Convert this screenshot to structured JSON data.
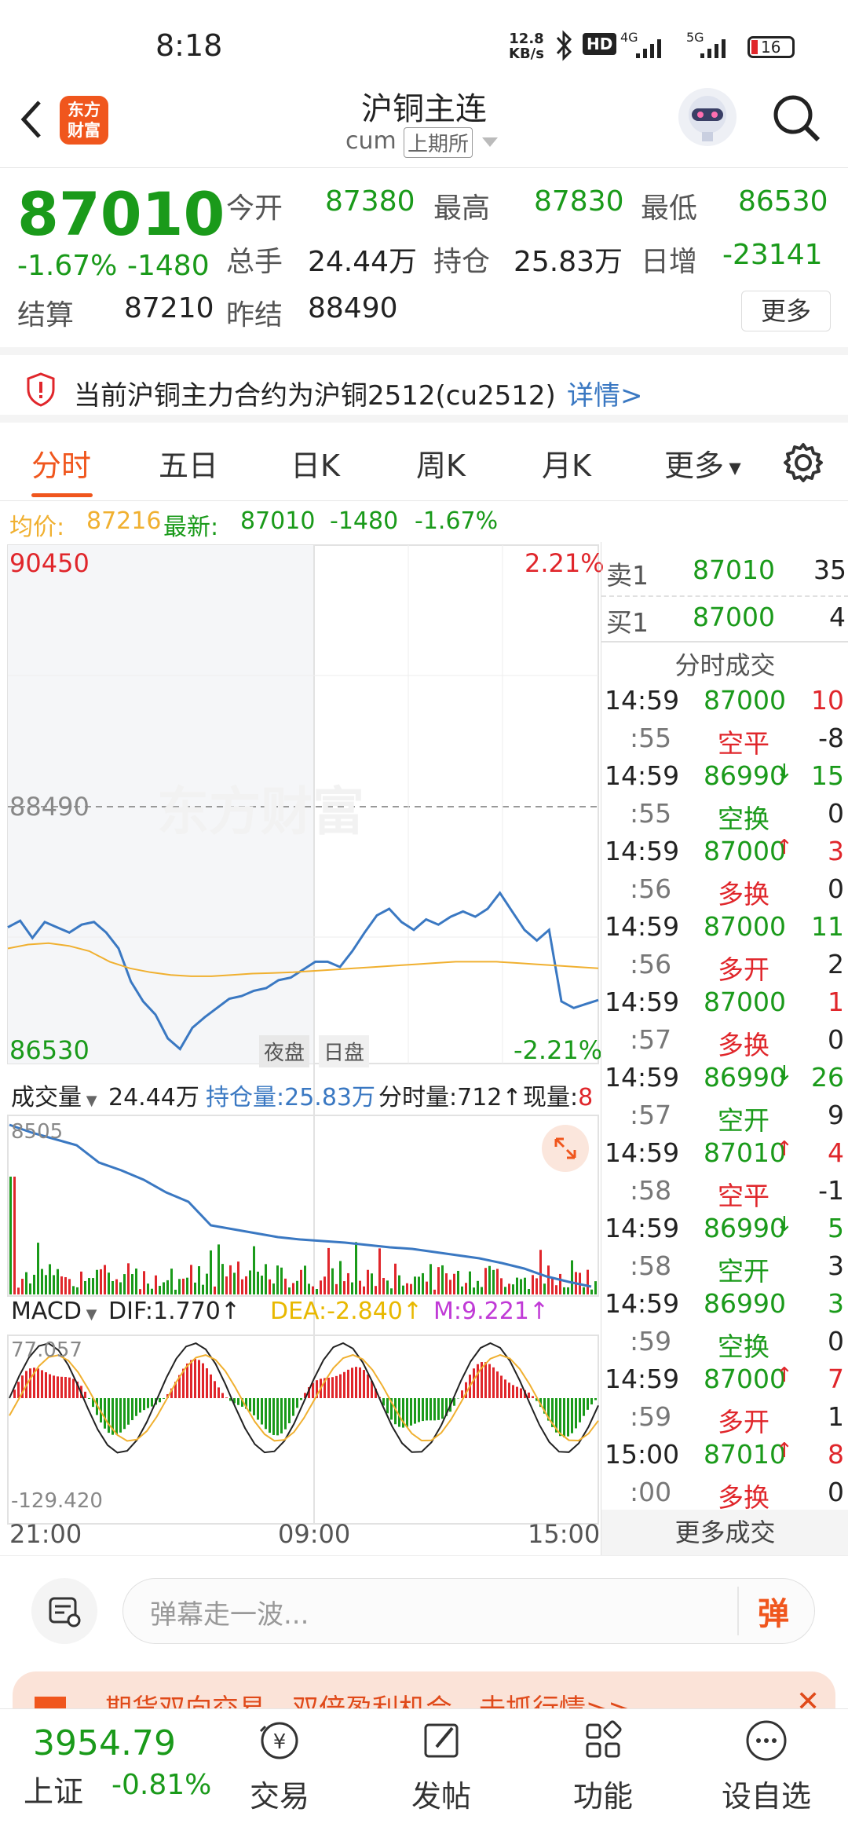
{
  "status": {
    "time": "8:18",
    "net_speed_top": "12.8",
    "net_speed_bottom": "KB/s",
    "hd": "HD",
    "net1": "4G",
    "net2": "5G",
    "battery": "16"
  },
  "header": {
    "title": "沪铜主连",
    "subtitle_code": "cum",
    "exchange": "上期所",
    "logo_line1": "东方",
    "logo_line2": "财富"
  },
  "quote": {
    "last": "87010",
    "change_pct": "-1.67%",
    "change": "-1480",
    "open_label": "今开",
    "open": "87380",
    "high_label": "最高",
    "high": "87830",
    "low_label": "最低",
    "low": "86530",
    "volume_label": "总手",
    "volume": "24.44万",
    "oi_label": "持仓",
    "oi": "25.83万",
    "oi_chg_label": "日增",
    "oi_chg": "-23141",
    "settle_label": "结算",
    "settle": "87210",
    "prev_settle_label": "昨结",
    "prev_settle": "88490",
    "more": "更多"
  },
  "notice": {
    "text": "当前沪铜主力合约为沪铜2512(cu2512)",
    "link": "详情>"
  },
  "tabs": [
    "分时",
    "五日",
    "日K",
    "周K",
    "月K",
    "更多"
  ],
  "avgline": {
    "avg_label": "均价:",
    "avg": "87216",
    "latest_label": "最新:",
    "latest": "87010",
    "chg": "-1480",
    "pct": "-1.67%"
  },
  "chart": {
    "y_high": "90450",
    "y_low": "86530",
    "y_ref": "88490",
    "pct_high": "2.21%",
    "pct_low": "-2.21%",
    "session_night": "夜盘",
    "session_day": "日盘",
    "watermark": "东方财富",
    "vol_select": "成交量",
    "vol_val": "24.44万",
    "oi_label": "持仓量:25.83万",
    "tick_vol": "分时量:712↑",
    "cur_vol_label": "现量:",
    "cur_vol": "8",
    "vol_max": "8505",
    "macd_select": "MACD",
    "dif": "DIF:1.770↑",
    "dea": "DEA:-2.840↑",
    "m": "M:9.221↑",
    "macd_max": "77.057",
    "macd_min": "-129.420",
    "x_start": "21:00",
    "x_mid": "09:00",
    "x_end": "15:00"
  },
  "chart_data": {
    "type": "line",
    "title": "",
    "x_labels": [
      "21:00",
      "09:00",
      "15:00"
    ],
    "ylim": [
      86530,
      90450
    ],
    "reference": 88490,
    "series": [
      {
        "values": [
          87560,
          87610,
          87480,
          87600,
          87560,
          87520,
          87580,
          87600,
          87520,
          87400,
          87150,
          87000,
          86900,
          86720,
          86640,
          86800,
          86880,
          86950,
          87020,
          87040,
          87080,
          87100,
          87160,
          87180,
          87240,
          87300,
          87300,
          87260,
          87380,
          87520,
          87650,
          87700,
          87600,
          87540,
          87620,
          87580,
          87640,
          87680,
          87640,
          87700,
          87820,
          87680,
          87540,
          87460,
          87540,
          87000,
          86950,
          86980,
          87010
        ]
      },
      {
        "values": [
          87400,
          87430,
          87440,
          87420,
          87380,
          87300,
          87250,
          87220,
          87200,
          87190,
          87190,
          87200,
          87210,
          87215,
          87220,
          87230,
          87240,
          87250,
          87260,
          87270,
          87280,
          87290,
          87300,
          87300,
          87300,
          87290,
          87280,
          87270,
          87260,
          87250
        ]
      }
    ]
  },
  "orderbook": {
    "ask_label": "卖1",
    "ask": "87010",
    "ask_vol": "35",
    "bid_label": "买1",
    "bid": "87000",
    "bid_vol": "4",
    "title": "分时成交",
    "trades": [
      {
        "t": "14:59",
        "p": "87000",
        "a": "",
        "v": "10",
        "pc": "green",
        "vc": "red"
      },
      {
        "t": ":55",
        "p": "空平",
        "a": "",
        "v": "-8",
        "pc": "red",
        "vc": "dark"
      },
      {
        "t": "14:59",
        "p": "86990",
        "a": "↓",
        "v": "15",
        "pc": "green",
        "vc": "green"
      },
      {
        "t": ":55",
        "p": "空换",
        "a": "",
        "v": "0",
        "pc": "green",
        "vc": "dark"
      },
      {
        "t": "14:59",
        "p": "87000",
        "a": "↑",
        "v": "3",
        "pc": "green",
        "vc": "red"
      },
      {
        "t": ":56",
        "p": "多换",
        "a": "",
        "v": "0",
        "pc": "red",
        "vc": "dark"
      },
      {
        "t": "14:59",
        "p": "87000",
        "a": "",
        "v": "11",
        "pc": "green",
        "vc": "green"
      },
      {
        "t": ":56",
        "p": "多开",
        "a": "",
        "v": "2",
        "pc": "red",
        "vc": "dark"
      },
      {
        "t": "14:59",
        "p": "87000",
        "a": "",
        "v": "1",
        "pc": "green",
        "vc": "red"
      },
      {
        "t": ":57",
        "p": "多换",
        "a": "",
        "v": "0",
        "pc": "red",
        "vc": "dark"
      },
      {
        "t": "14:59",
        "p": "86990",
        "a": "↓",
        "v": "26",
        "pc": "green",
        "vc": "green"
      },
      {
        "t": ":57",
        "p": "空开",
        "a": "",
        "v": "9",
        "pc": "green",
        "vc": "dark"
      },
      {
        "t": "14:59",
        "p": "87010",
        "a": "↑",
        "v": "4",
        "pc": "green",
        "vc": "red"
      },
      {
        "t": ":58",
        "p": "空平",
        "a": "",
        "v": "-1",
        "pc": "red",
        "vc": "dark"
      },
      {
        "t": "14:59",
        "p": "86990",
        "a": "↓",
        "v": "5",
        "pc": "green",
        "vc": "green"
      },
      {
        "t": ":58",
        "p": "空开",
        "a": "",
        "v": "3",
        "pc": "green",
        "vc": "dark"
      },
      {
        "t": "14:59",
        "p": "86990",
        "a": "",
        "v": "3",
        "pc": "green",
        "vc": "green"
      },
      {
        "t": ":59",
        "p": "空换",
        "a": "",
        "v": "0",
        "pc": "green",
        "vc": "dark"
      },
      {
        "t": "14:59",
        "p": "87000",
        "a": "↑",
        "v": "7",
        "pc": "green",
        "vc": "red"
      },
      {
        "t": ":59",
        "p": "多开",
        "a": "",
        "v": "1",
        "pc": "red",
        "vc": "dark"
      },
      {
        "t": "15:00",
        "p": "87010",
        "a": "↑",
        "v": "8",
        "pc": "green",
        "vc": "red"
      },
      {
        "t": ":00",
        "p": "多换",
        "a": "",
        "v": "0",
        "pc": "red",
        "vc": "dark"
      }
    ],
    "more": "更多成交"
  },
  "comment": {
    "placeholder": "弹幕走一波...",
    "send": "弹"
  },
  "banner": {
    "text": "期货双向交易，双倍盈利机会，去抓行情>>"
  },
  "bottomnav": {
    "index_val": "3954.79",
    "index_name": "上证",
    "index_pct": "-0.81%",
    "items": [
      "交易",
      "发帖",
      "功能",
      "设自选"
    ]
  },
  "colors": {
    "up": "#e0262b",
    "down": "#1a9a1a",
    "accent": "#f0561d",
    "line": "#3a78c2",
    "avg": "#f0b030"
  }
}
